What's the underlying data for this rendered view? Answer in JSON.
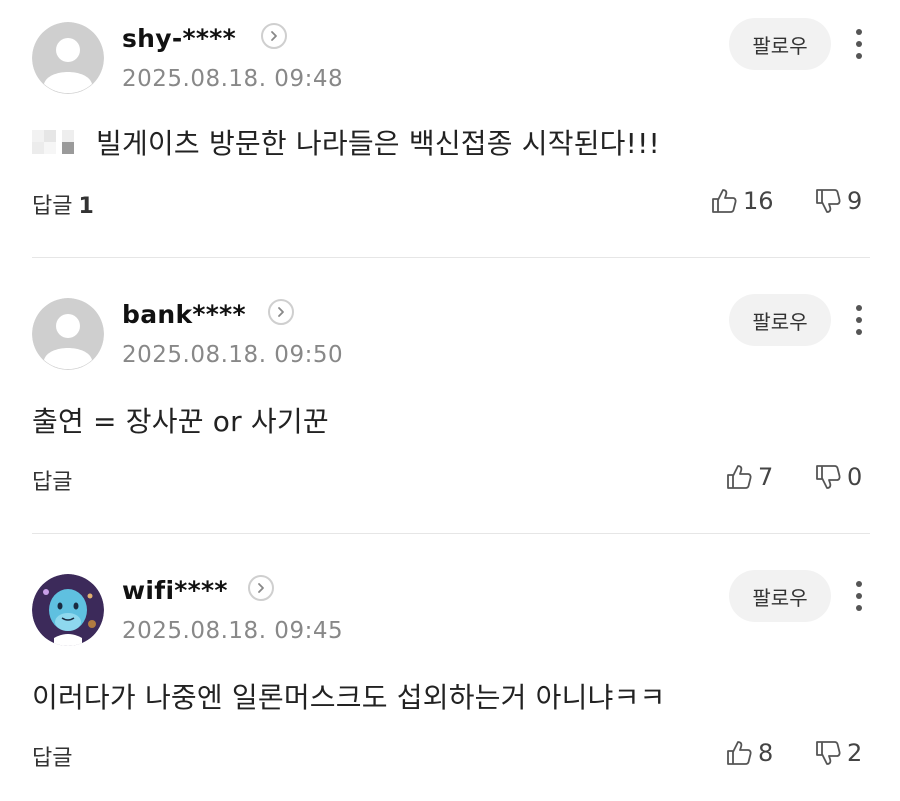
{
  "comments": [
    {
      "username": "shy-****",
      "timestamp": "2025.08.18. 09:48",
      "follow_label": "팔로우",
      "text": "빌게이츠 방문한 나라들은 백신접종 시작된다!!!",
      "reply_label": "답글",
      "reply_count": "1",
      "likes": "16",
      "dislikes": "9",
      "avatar": "default-avatar"
    },
    {
      "username": "bank****",
      "timestamp": "2025.08.18. 09:50",
      "follow_label": "팔로우",
      "text": "출연 = 장사꾼 or 사기꾼",
      "reply_label": "답글",
      "reply_count": "",
      "likes": "7",
      "dislikes": "0",
      "avatar": "default-avatar"
    },
    {
      "username": "wifi****",
      "timestamp": "2025.08.18. 09:45",
      "follow_label": "팔로우",
      "text": "이러다가 나중엔 일론머스크도 섭외하는거 아니냐ㅋㅋ",
      "reply_label": "답글",
      "reply_count": "",
      "likes": "8",
      "dislikes": "2",
      "avatar": "character-avatar"
    }
  ],
  "icons": {
    "like": "thumbs-up-icon",
    "dislike": "thumbs-down-icon",
    "more": "more-vertical-icon",
    "profile": "chevron-right-icon"
  },
  "colors": {
    "username": "#111111",
    "timestamp": "#888888",
    "follow_bg": "#f2f2f2",
    "divider": "#e6e6e6"
  }
}
